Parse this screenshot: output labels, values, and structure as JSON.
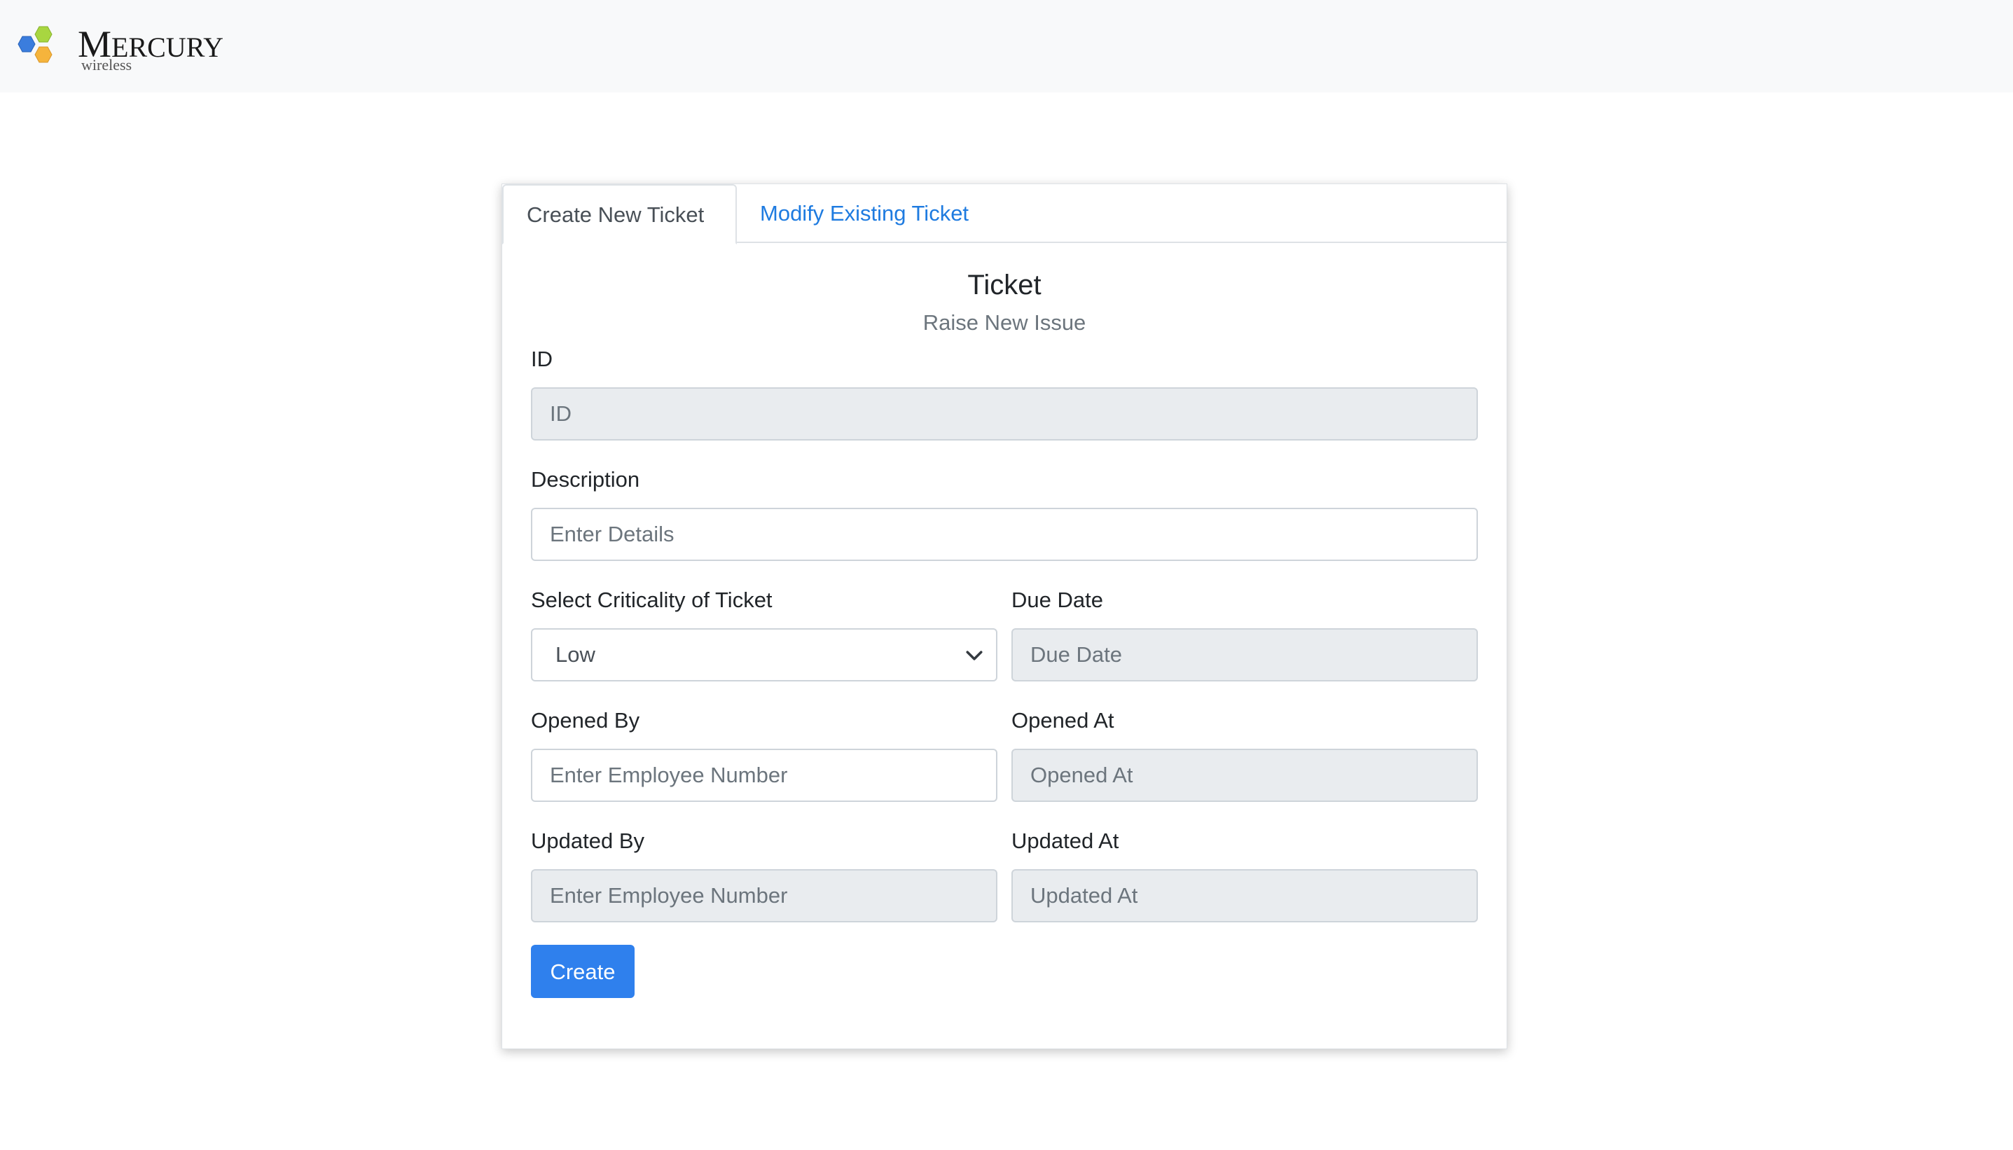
{
  "header": {
    "logo_word": "Mercury",
    "logo_sub": "wireless"
  },
  "tabs": [
    {
      "label": "Create New Ticket",
      "active": true
    },
    {
      "label": "Modify Existing Ticket",
      "active": false
    }
  ],
  "form": {
    "title": "Ticket",
    "subtitle": "Raise New Issue",
    "id": {
      "label": "ID",
      "placeholder": "ID",
      "disabled": true
    },
    "description": {
      "label": "Description",
      "placeholder": "Enter Details"
    },
    "criticality": {
      "label": "Select Criticality of Ticket",
      "selected": "Low"
    },
    "due_date": {
      "label": "Due Date",
      "placeholder": "Due Date",
      "disabled": true
    },
    "opened_by": {
      "label": "Opened By",
      "placeholder": "Enter Employee Number"
    },
    "opened_at": {
      "label": "Opened At",
      "placeholder": "Opened At",
      "disabled": true
    },
    "updated_by": {
      "label": "Updated By",
      "placeholder": "Enter Employee Number",
      "disabled": true
    },
    "updated_at": {
      "label": "Updated At",
      "placeholder": "Updated At",
      "disabled": true
    },
    "submit_label": "Create"
  },
  "colors": {
    "accent": "#2f80ed",
    "link": "#1e7be0",
    "header_bg": "#f8f9fa",
    "disabled_bg": "#e9ecef",
    "logo_hex_blue": "#3b7ddd",
    "logo_hex_green": "#a8d640",
    "logo_hex_orange": "#f5b43c"
  },
  "icons": {
    "logo": "hexagon-cluster-icon",
    "select_arrow": "chevron-down-icon"
  }
}
